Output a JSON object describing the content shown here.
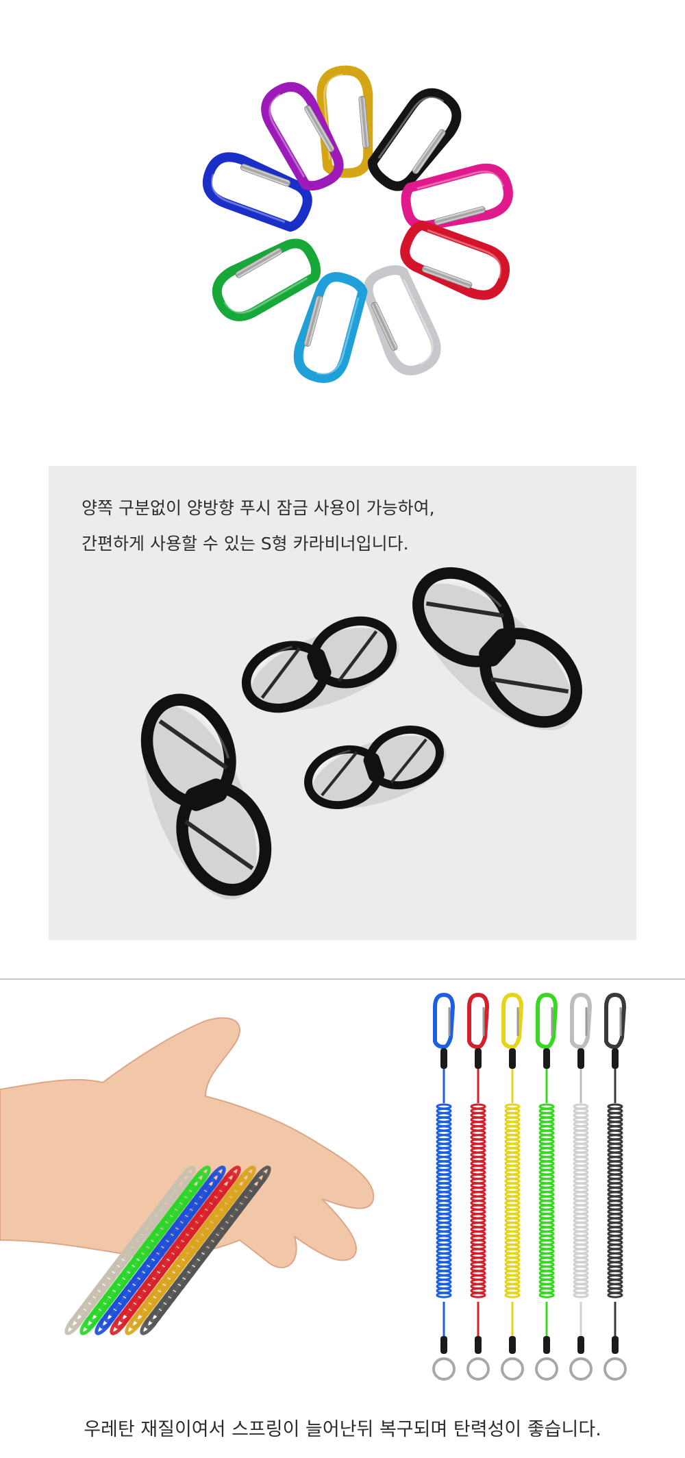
{
  "section_s_carabiner": {
    "caption_line1": "양쪽 구분없이 양방향 푸시 잠금 사용이 가능하여,",
    "caption_line2": "간편하게 사용할 수 있는 S형 카라비너입니다."
  },
  "section_coil": {
    "caption": "우레탄 재질이여서 스프링이 늘어난뒤 복구되며 탄력성이 좋습니다."
  },
  "colors": {
    "carabiner_ring": [
      "#d4a514",
      "#141414",
      "#e01a8c",
      "#d4142a",
      "#c8c8cc",
      "#1fa0d8",
      "#18a83a",
      "#1a2fc8",
      "#9c1ab8"
    ],
    "lanyards": [
      "#1d5fe0",
      "#d4202a",
      "#e6d41a",
      "#3ad624",
      "#e6e6e6",
      "#3a3a3a"
    ],
    "s_carabiner": "#111111",
    "panel_bg": "#ececec"
  }
}
